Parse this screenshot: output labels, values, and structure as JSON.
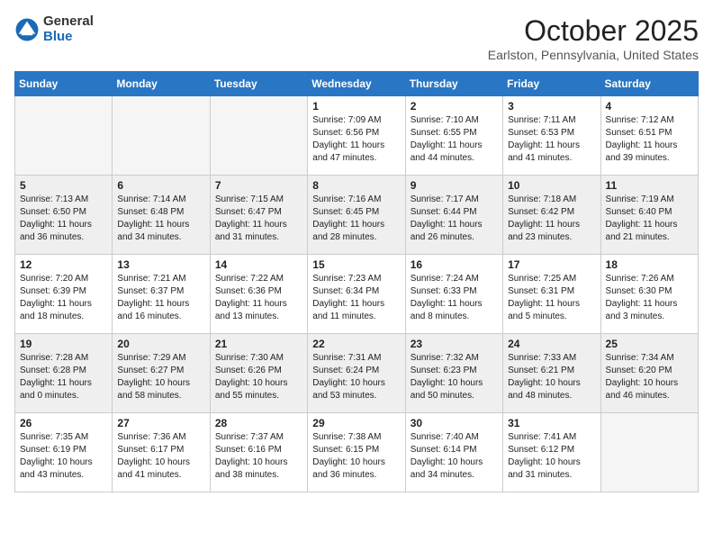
{
  "header": {
    "logo_general": "General",
    "logo_blue": "Blue",
    "month": "October 2025",
    "location": "Earlston, Pennsylvania, United States"
  },
  "days_of_week": [
    "Sunday",
    "Monday",
    "Tuesday",
    "Wednesday",
    "Thursday",
    "Friday",
    "Saturday"
  ],
  "weeks": [
    [
      {
        "day": "",
        "text": "",
        "empty": true
      },
      {
        "day": "",
        "text": "",
        "empty": true
      },
      {
        "day": "",
        "text": "",
        "empty": true
      },
      {
        "day": "1",
        "text": "Sunrise: 7:09 AM\nSunset: 6:56 PM\nDaylight: 11 hours\nand 47 minutes."
      },
      {
        "day": "2",
        "text": "Sunrise: 7:10 AM\nSunset: 6:55 PM\nDaylight: 11 hours\nand 44 minutes."
      },
      {
        "day": "3",
        "text": "Sunrise: 7:11 AM\nSunset: 6:53 PM\nDaylight: 11 hours\nand 41 minutes."
      },
      {
        "day": "4",
        "text": "Sunrise: 7:12 AM\nSunset: 6:51 PM\nDaylight: 11 hours\nand 39 minutes."
      }
    ],
    [
      {
        "day": "5",
        "text": "Sunrise: 7:13 AM\nSunset: 6:50 PM\nDaylight: 11 hours\nand 36 minutes.",
        "gray": true
      },
      {
        "day": "6",
        "text": "Sunrise: 7:14 AM\nSunset: 6:48 PM\nDaylight: 11 hours\nand 34 minutes.",
        "gray": true
      },
      {
        "day": "7",
        "text": "Sunrise: 7:15 AM\nSunset: 6:47 PM\nDaylight: 11 hours\nand 31 minutes.",
        "gray": true
      },
      {
        "day": "8",
        "text": "Sunrise: 7:16 AM\nSunset: 6:45 PM\nDaylight: 11 hours\nand 28 minutes.",
        "gray": true
      },
      {
        "day": "9",
        "text": "Sunrise: 7:17 AM\nSunset: 6:44 PM\nDaylight: 11 hours\nand 26 minutes.",
        "gray": true
      },
      {
        "day": "10",
        "text": "Sunrise: 7:18 AM\nSunset: 6:42 PM\nDaylight: 11 hours\nand 23 minutes.",
        "gray": true
      },
      {
        "day": "11",
        "text": "Sunrise: 7:19 AM\nSunset: 6:40 PM\nDaylight: 11 hours\nand 21 minutes.",
        "gray": true
      }
    ],
    [
      {
        "day": "12",
        "text": "Sunrise: 7:20 AM\nSunset: 6:39 PM\nDaylight: 11 hours\nand 18 minutes."
      },
      {
        "day": "13",
        "text": "Sunrise: 7:21 AM\nSunset: 6:37 PM\nDaylight: 11 hours\nand 16 minutes."
      },
      {
        "day": "14",
        "text": "Sunrise: 7:22 AM\nSunset: 6:36 PM\nDaylight: 11 hours\nand 13 minutes."
      },
      {
        "day": "15",
        "text": "Sunrise: 7:23 AM\nSunset: 6:34 PM\nDaylight: 11 hours\nand 11 minutes."
      },
      {
        "day": "16",
        "text": "Sunrise: 7:24 AM\nSunset: 6:33 PM\nDaylight: 11 hours\nand 8 minutes."
      },
      {
        "day": "17",
        "text": "Sunrise: 7:25 AM\nSunset: 6:31 PM\nDaylight: 11 hours\nand 5 minutes."
      },
      {
        "day": "18",
        "text": "Sunrise: 7:26 AM\nSunset: 6:30 PM\nDaylight: 11 hours\nand 3 minutes."
      }
    ],
    [
      {
        "day": "19",
        "text": "Sunrise: 7:28 AM\nSunset: 6:28 PM\nDaylight: 11 hours\nand 0 minutes.",
        "gray": true
      },
      {
        "day": "20",
        "text": "Sunrise: 7:29 AM\nSunset: 6:27 PM\nDaylight: 10 hours\nand 58 minutes.",
        "gray": true
      },
      {
        "day": "21",
        "text": "Sunrise: 7:30 AM\nSunset: 6:26 PM\nDaylight: 10 hours\nand 55 minutes.",
        "gray": true
      },
      {
        "day": "22",
        "text": "Sunrise: 7:31 AM\nSunset: 6:24 PM\nDaylight: 10 hours\nand 53 minutes.",
        "gray": true
      },
      {
        "day": "23",
        "text": "Sunrise: 7:32 AM\nSunset: 6:23 PM\nDaylight: 10 hours\nand 50 minutes.",
        "gray": true
      },
      {
        "day": "24",
        "text": "Sunrise: 7:33 AM\nSunset: 6:21 PM\nDaylight: 10 hours\nand 48 minutes.",
        "gray": true
      },
      {
        "day": "25",
        "text": "Sunrise: 7:34 AM\nSunset: 6:20 PM\nDaylight: 10 hours\nand 46 minutes.",
        "gray": true
      }
    ],
    [
      {
        "day": "26",
        "text": "Sunrise: 7:35 AM\nSunset: 6:19 PM\nDaylight: 10 hours\nand 43 minutes."
      },
      {
        "day": "27",
        "text": "Sunrise: 7:36 AM\nSunset: 6:17 PM\nDaylight: 10 hours\nand 41 minutes."
      },
      {
        "day": "28",
        "text": "Sunrise: 7:37 AM\nSunset: 6:16 PM\nDaylight: 10 hours\nand 38 minutes."
      },
      {
        "day": "29",
        "text": "Sunrise: 7:38 AM\nSunset: 6:15 PM\nDaylight: 10 hours\nand 36 minutes."
      },
      {
        "day": "30",
        "text": "Sunrise: 7:40 AM\nSunset: 6:14 PM\nDaylight: 10 hours\nand 34 minutes."
      },
      {
        "day": "31",
        "text": "Sunrise: 7:41 AM\nSunset: 6:12 PM\nDaylight: 10 hours\nand 31 minutes."
      },
      {
        "day": "",
        "text": "",
        "empty": true
      }
    ]
  ]
}
